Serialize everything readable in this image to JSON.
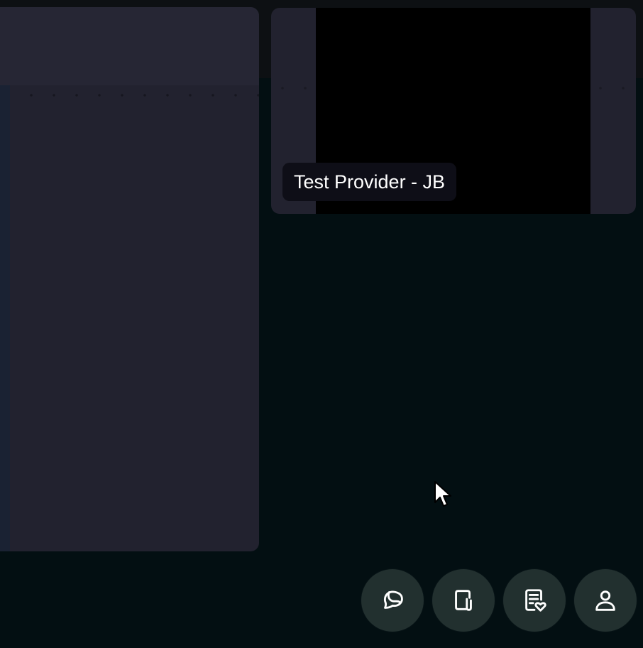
{
  "remote_participant": {
    "name": "Test Provider - JB"
  },
  "toolbar": {
    "buttons": [
      {
        "icon": "chat-icon"
      },
      {
        "icon": "attachment-icon"
      },
      {
        "icon": "health-record-icon"
      },
      {
        "icon": "profile-icon"
      }
    ]
  },
  "colors": {
    "background": "#030f12",
    "tile": "#22222f",
    "video": "#000000",
    "badge": "#0e0e17",
    "button": "#22302f",
    "icon": "#ffffff"
  }
}
